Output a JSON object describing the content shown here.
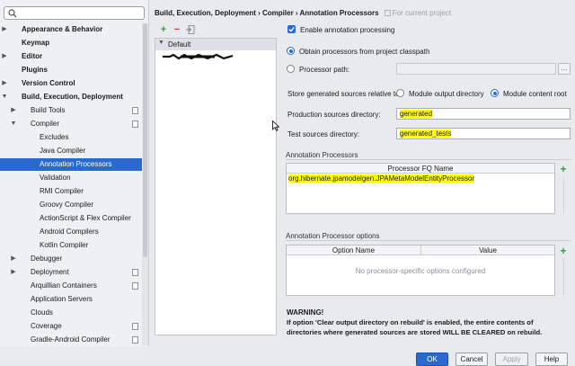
{
  "search": {
    "placeholder": "",
    "value": ""
  },
  "tree": [
    {
      "label": "Appearance & Behavior",
      "level": 0,
      "expand": "collapsed",
      "bold": true,
      "project": false
    },
    {
      "label": "Keymap",
      "level": 0,
      "expand": "none",
      "bold": true,
      "project": false
    },
    {
      "label": "Editor",
      "level": 0,
      "expand": "collapsed",
      "bold": true,
      "project": false
    },
    {
      "label": "Plugins",
      "level": 0,
      "expand": "none",
      "bold": true,
      "project": false
    },
    {
      "label": "Version Control",
      "level": 0,
      "expand": "collapsed",
      "bold": true,
      "project": false
    },
    {
      "label": "Build, Execution, Deployment",
      "level": 0,
      "expand": "expanded",
      "bold": true,
      "project": false
    },
    {
      "label": "Build Tools",
      "level": 1,
      "expand": "collapsed",
      "bold": false,
      "project": true
    },
    {
      "label": "Compiler",
      "level": 1,
      "expand": "expanded",
      "bold": false,
      "project": true
    },
    {
      "label": "Excludes",
      "level": 2,
      "expand": "none",
      "bold": false,
      "project": false
    },
    {
      "label": "Java Compiler",
      "level": 2,
      "expand": "none",
      "bold": false,
      "project": false
    },
    {
      "label": "Annotation Processors",
      "level": 2,
      "expand": "none",
      "bold": false,
      "project": false,
      "selected": true
    },
    {
      "label": "Validation",
      "level": 2,
      "expand": "none",
      "bold": false,
      "project": false
    },
    {
      "label": "RMI Compiler",
      "level": 2,
      "expand": "none",
      "bold": false,
      "project": false
    },
    {
      "label": "Groovy Compiler",
      "level": 2,
      "expand": "none",
      "bold": false,
      "project": false
    },
    {
      "label": "ActionScript & Flex Compiler",
      "level": 2,
      "expand": "none",
      "bold": false,
      "project": false
    },
    {
      "label": "Android Compilers",
      "level": 2,
      "expand": "none",
      "bold": false,
      "project": false
    },
    {
      "label": "Kotlin Compiler",
      "level": 2,
      "expand": "none",
      "bold": false,
      "project": false
    },
    {
      "label": "Debugger",
      "level": 1,
      "expand": "collapsed",
      "bold": false,
      "project": false
    },
    {
      "label": "Deployment",
      "level": 1,
      "expand": "collapsed",
      "bold": false,
      "project": true
    },
    {
      "label": "Arquillian Containers",
      "level": 1,
      "expand": "none",
      "bold": false,
      "project": true
    },
    {
      "label": "Application Servers",
      "level": 1,
      "expand": "none",
      "bold": false,
      "project": false
    },
    {
      "label": "Clouds",
      "level": 1,
      "expand": "none",
      "bold": false,
      "project": false
    },
    {
      "label": "Coverage",
      "level": 1,
      "expand": "none",
      "bold": false,
      "project": true
    },
    {
      "label": "Gradle-Android Compiler",
      "level": 1,
      "expand": "none",
      "bold": false,
      "project": true
    }
  ],
  "header": {
    "breadcrumb": "Build, Execution, Deployment › Compiler › Annotation Processors",
    "for_project": "For current project"
  },
  "profiles": {
    "default_label": "Default"
  },
  "settings": {
    "enable_label": "Enable annotation processing",
    "obtain_label": "Obtain processors from project classpath",
    "path_label": "Processor path:",
    "path_value": "",
    "browse_label": "...",
    "store_label": "Store generated sources relative to:",
    "module_output_label": "Module output directory",
    "module_content_label": "Module content root",
    "production_label": "Production sources directory:",
    "production_value": "generated",
    "test_label": "Test sources directory:",
    "test_value": "generated_tests"
  },
  "processors": {
    "section_title": "Annotation Processors",
    "column": "Processor FQ Name",
    "rows": [
      "org.hibernate.jpamodelgen.JPAMetaModelEntityProcessor"
    ]
  },
  "options": {
    "section_title": "Annotation Processor options",
    "col_name": "Option Name",
    "col_value": "Value",
    "empty_text": "No processor-specific options configured"
  },
  "warning": {
    "title": "WARNING!",
    "text": "If option 'Clear output directory on rebuild' is enabled, the entire contents of directories where generated sources are stored WILL BE CLEARED on rebuild."
  },
  "buttons": {
    "ok": "OK",
    "cancel": "Cancel",
    "apply": "Apply",
    "help": "Help"
  },
  "colors": {
    "accent": "#2a6acf",
    "highlight": "#ffff00",
    "add_green": "#2ea043",
    "remove_red": "#d63b3b"
  }
}
